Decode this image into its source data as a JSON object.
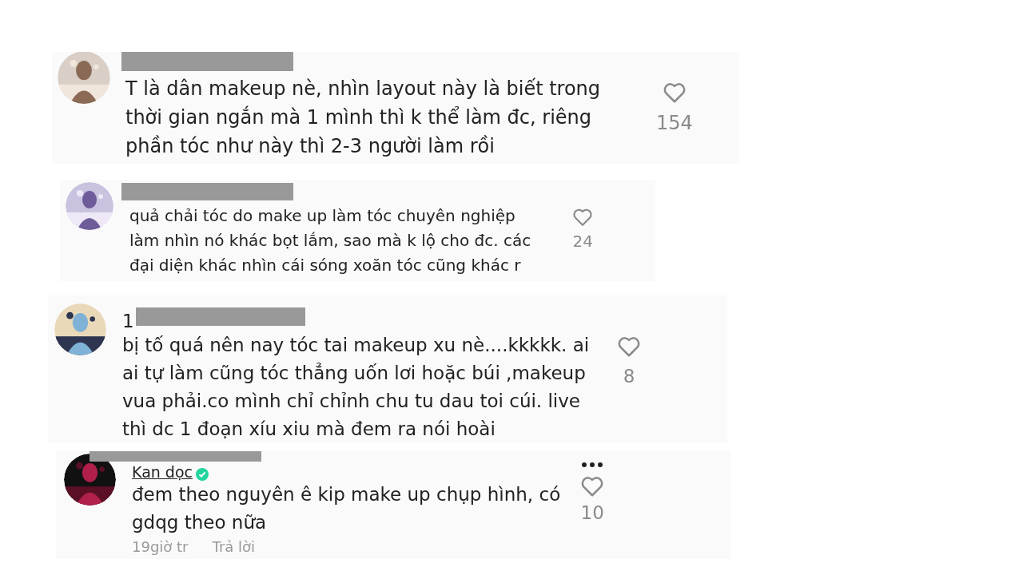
{
  "comments": [
    {
      "redacted": true,
      "text_lines": [
        "T là dân makeup nè, nhìn layout này là biết trong",
        "thời gian ngắn mà 1 mình thì k thể làm đc, riêng",
        "phần tóc như này thì 2-3 người làm rồi"
      ],
      "likes": "154"
    },
    {
      "redacted": true,
      "text_lines": [
        "quả chải tóc do make up làm tóc chuyên nghiệp",
        "làm nhìn nó khác bọt lắm, sao mà k lộ cho đc. các",
        "đại diện khác nhìn cái sóng xoăn tóc cũng khác r"
      ],
      "likes": "24"
    },
    {
      "author": "1",
      "redacted": true,
      "text_lines": [
        "bị tố quá nên nay tóc tai makeup xu nè....kkkkk. ai",
        "ai tự làm cũng tóc thẳng uốn lơi hoặc búi ,makeup",
        "vua phải.co mình chỉ chỉnh chu tu dau toi cúi. live",
        "thì dc 1 đoạn xíu xiu mà đem ra nói hoài"
      ],
      "likes": "8"
    },
    {
      "author": "Kan dọc",
      "verified": true,
      "redacted": true,
      "more_menu": true,
      "text_lines": [
        "đem theo nguyên ê kip make up chụp hình, có",
        "gdqg theo nữa"
      ],
      "time": "19giờ tr",
      "reply": "Trả lời",
      "likes": "10"
    }
  ]
}
